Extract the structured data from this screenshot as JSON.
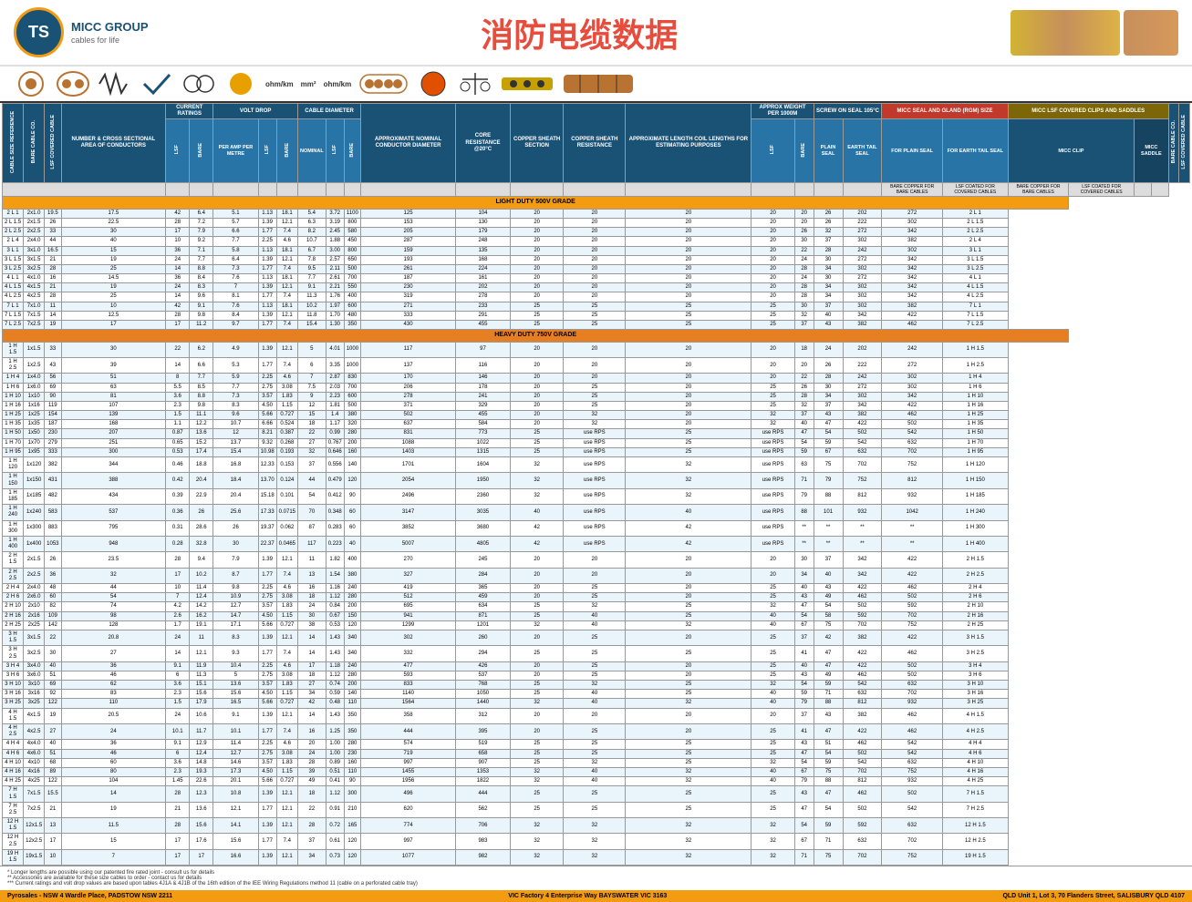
{
  "page": {
    "title": "消防电缆数据",
    "logo_text": "MICC GROUP",
    "logo_subtitle": "cables for life",
    "logo_initials": "TS"
  },
  "columns": {
    "cable_size": "CABLE SIZE REFERENCE",
    "bare_cable": "BARE CABLE CO.",
    "lsf_cable": "LSF COVERED CABLE",
    "num_conductors": "NUMBER & CROSS SECTIONAL AREA OF CONDUCTORS",
    "current_lsf": "LSF",
    "current_bare": "BARE",
    "volt_drop_per_amp": "PER AMP PER METRE",
    "volt_drop_lsf": "LSF",
    "volt_drop_bare": "BARE",
    "cable_dia_nominal": "NOMINAL CONDUCTOR DIAMETER",
    "cable_dia_lsf": "LSF",
    "cable_dia_bare": "BARE",
    "copper_sheath_section": "COPPER SHEATH SECTION",
    "copper_sheath_resistance": "COPPER SHEATH RESISTANCE",
    "approx_length": "APPROXIMATE LENGTH COIL LENGTHS FOR ESTIMATING PURPOSES",
    "weight_lsf": "LSF",
    "weight_bare": "BARE",
    "screw_plain": "PLAIN SEAL",
    "screw_earth": "EARTH TAIL SEAL",
    "for_plain_seal": "FOR PLAIN SEAL",
    "for_earth_tail_seal": "FOR EARTH TAIL SEAL",
    "bare_copper_bare": "BARE COPPER FOR BARE CABLES",
    "lsf_covered": "LSF COATED FOR COVERED CABLES",
    "bare_copper_covered": "BARE COPPER FOR BARE CABLES",
    "lsf_saddle": "LSF COATED FOR COVERED CABLES"
  },
  "section_labels": {
    "light_duty": "LIGHT DUTY 500V GRADE",
    "heavy_duty": "HEAVY DUTY 750V GRADE",
    "light_duty_right": "LIGHT DUTY 500V GRADE",
    "heavy_duty_right": "HEAVY DUTY 750V GRADE"
  },
  "rows_light_duty": [
    [
      "2 L 1",
      "2x1.0",
      "19.5",
      "17.5",
      "42",
      "6.4",
      "5.1",
      "1.13",
      "18.1",
      "5.4",
      "3.72",
      "1100",
      "125",
      "104",
      "20",
      "20",
      "20",
      "20",
      "20",
      "26",
      "202",
      "272",
      "2 L 1"
    ],
    [
      "2 L 1.5",
      "2x1.5",
      "26",
      "22.5",
      "28",
      "7.2",
      "5.7",
      "1.39",
      "12.1",
      "6.3",
      "3.19",
      "800",
      "153",
      "130",
      "20",
      "20",
      "20",
      "20",
      "20",
      "26",
      "222",
      "302",
      "2 L 1.5"
    ],
    [
      "2 L 2.5",
      "2x2.5",
      "33",
      "30",
      "17",
      "7.9",
      "6.6",
      "1.77",
      "7.4",
      "8.2",
      "2.45",
      "580",
      "205",
      "179",
      "20",
      "20",
      "20",
      "20",
      "26",
      "32",
      "272",
      "342",
      "2 L 2.5"
    ],
    [
      "2 L 4",
      "2x4.0",
      "44",
      "40",
      "10",
      "9.2",
      "7.7",
      "2.25",
      "4.6",
      "10.7",
      "1.88",
      "450",
      "287",
      "248",
      "20",
      "20",
      "20",
      "20",
      "30",
      "37",
      "302",
      "382",
      "2 L 4"
    ],
    [
      "3 L 1",
      "3x1.0",
      "16.5",
      "15",
      "36",
      "7.1",
      "5.8",
      "1.13",
      "18.1",
      "6.7",
      "3.00",
      "800",
      "159",
      "135",
      "20",
      "20",
      "20",
      "20",
      "22",
      "28",
      "242",
      "302",
      "3 L 1"
    ],
    [
      "3 L 1.5",
      "3x1.5",
      "21",
      "19",
      "24",
      "7.7",
      "6.4",
      "1.39",
      "12.1",
      "7.8",
      "2.57",
      "650",
      "193",
      "168",
      "20",
      "20",
      "20",
      "20",
      "24",
      "30",
      "272",
      "342",
      "3 L 1.5"
    ],
    [
      "3 L 2.5",
      "3x2.5",
      "28",
      "25",
      "14",
      "8.8",
      "7.3",
      "1.77",
      "7.4",
      "9.5",
      "2.11",
      "500",
      "261",
      "224",
      "20",
      "20",
      "20",
      "20",
      "28",
      "34",
      "302",
      "342",
      "3 L 2.5"
    ],
    [
      "4 L 1",
      "4x1.0",
      "16",
      "14.5",
      "36",
      "8.4",
      "7.6",
      "1.13",
      "18.1",
      "7.7",
      "2.61",
      "700",
      "187",
      "161",
      "20",
      "20",
      "20",
      "20",
      "24",
      "30",
      "272",
      "342",
      "4 L 1"
    ],
    [
      "4 L 1.5",
      "4x1.5",
      "21",
      "19",
      "24",
      "8.3",
      "7",
      "1.39",
      "12.1",
      "9.1",
      "2.21",
      "550",
      "230",
      "202",
      "20",
      "20",
      "20",
      "20",
      "28",
      "34",
      "302",
      "342",
      "4 L 1.5"
    ],
    [
      "4 L 2.5",
      "4x2.5",
      "28",
      "25",
      "14",
      "9.6",
      "8.1",
      "1.77",
      "7.4",
      "11.3",
      "1.76",
      "400",
      "319",
      "278",
      "20",
      "20",
      "20",
      "20",
      "28",
      "34",
      "302",
      "342",
      "4 L 2.5"
    ],
    [
      "7 L 1",
      "7x1.0",
      "11",
      "10",
      "42",
      "9.1",
      "7.6",
      "1.13",
      "18.1",
      "10.2",
      "1.97",
      "600",
      "271",
      "233",
      "25",
      "25",
      "25",
      "25",
      "30",
      "37",
      "302",
      "382",
      "7 L 1"
    ],
    [
      "7 L 1.5",
      "7x1.5",
      "14",
      "12.5",
      "28",
      "9.8",
      "8.4",
      "1.39",
      "12.1",
      "11.8",
      "1.70",
      "480",
      "333",
      "291",
      "25",
      "25",
      "25",
      "25",
      "32",
      "40",
      "342",
      "422",
      "7 L 1.5"
    ],
    [
      "7 L 2.5",
      "7x2.5",
      "19",
      "17",
      "17",
      "11.2",
      "9.7",
      "1.77",
      "7.4",
      "15.4",
      "1.30",
      "350",
      "430",
      "455",
      "25",
      "25",
      "25",
      "25",
      "37",
      "43",
      "382",
      "462",
      "7 L 2.5"
    ]
  ],
  "rows_heavy_duty": [
    [
      "1 H 1.5",
      "1x1.5",
      "33",
      "30",
      "22",
      "6.2",
      "4.9",
      "1.39",
      "12.1",
      "5",
      "4.01",
      "1000",
      "117",
      "97",
      "20",
      "20",
      "20",
      "20",
      "18",
      "24",
      "202",
      "242",
      "1 H 1.5"
    ],
    [
      "1 H 2.5",
      "1x2.5",
      "43",
      "39",
      "14",
      "6.6",
      "5.3",
      "1.77",
      "7.4",
      "6",
      "3.35",
      "1000",
      "137",
      "116",
      "20",
      "20",
      "20",
      "20",
      "20",
      "26",
      "222",
      "272",
      "1 H 2.5"
    ],
    [
      "1 H 4",
      "1x4.0",
      "56",
      "51",
      "8",
      "7.7",
      "5.9",
      "2.25",
      "4.6",
      "7",
      "2.87",
      "830",
      "170",
      "146",
      "20",
      "20",
      "20",
      "20",
      "22",
      "28",
      "242",
      "302",
      "1 H 4"
    ],
    [
      "1 H 6",
      "1x6.0",
      "69",
      "63",
      "5.5",
      "8.5",
      "7.7",
      "2.75",
      "3.08",
      "7.5",
      "2.03",
      "700",
      "206",
      "178",
      "20",
      "25",
      "20",
      "25",
      "26",
      "30",
      "272",
      "302",
      "1 H 6"
    ],
    [
      "1 H 10",
      "1x10",
      "90",
      "81",
      "3.6",
      "8.8",
      "7.3",
      "3.57",
      "1.83",
      "9",
      "2.23",
      "600",
      "278",
      "241",
      "20",
      "25",
      "20",
      "25",
      "28",
      "34",
      "302",
      "342",
      "1 H 10"
    ],
    [
      "1 H 16",
      "1x16",
      "119",
      "107",
      "2.3",
      "9.8",
      "8.3",
      "4.50",
      "1.15",
      "12",
      "1.81",
      "500",
      "371",
      "329",
      "20",
      "25",
      "20",
      "25",
      "32",
      "37",
      "342",
      "422",
      "1 H 16"
    ],
    [
      "1 H 25",
      "1x25",
      "154",
      "139",
      "1.5",
      "11.1",
      "9.6",
      "5.66",
      "0.727",
      "15",
      "1.4",
      "380",
      "502",
      "455",
      "20",
      "32",
      "20",
      "32",
      "37",
      "43",
      "382",
      "462",
      "1 H 25"
    ],
    [
      "1 H 35",
      "1x35",
      "187",
      "168",
      "1.1",
      "12.2",
      "10.7",
      "6.66",
      "0.524",
      "18",
      "1.17",
      "320",
      "637",
      "584",
      "20",
      "32",
      "20",
      "32",
      "40",
      "47",
      "422",
      "502",
      "1 H 35"
    ],
    [
      "1 H 50",
      "1x50",
      "230",
      "207",
      "0.87",
      "13.6",
      "12",
      "8.21",
      "0.387",
      "22",
      "0.99",
      "280",
      "831",
      "773",
      "25",
      "use RPS",
      "25",
      "use RPS",
      "47",
      "54",
      "502",
      "542",
      "1 H 50"
    ],
    [
      "1 H 70",
      "1x70",
      "279",
      "251",
      "0.65",
      "15.2",
      "13.7",
      "9.32",
      "0.268",
      "27",
      "0.767",
      "200",
      "1088",
      "1022",
      "25",
      "use RPS",
      "25",
      "use RPS",
      "54",
      "59",
      "542",
      "632",
      "1 H 70"
    ],
    [
      "1 H 95",
      "1x95",
      "333",
      "300",
      "0.53",
      "17.4",
      "15.4",
      "10.98",
      "0.193",
      "32",
      "0.646",
      "160",
      "1403",
      "1315",
      "25",
      "use RPS",
      "25",
      "use RPS",
      "59",
      "67",
      "632",
      "702",
      "1 H 95"
    ],
    [
      "1 H 120",
      "1x120",
      "382",
      "344",
      "0.46",
      "18.8",
      "16.8",
      "12.33",
      "0.153",
      "37",
      "0.556",
      "140",
      "1701",
      "1604",
      "32",
      "use RPS",
      "32",
      "use RPS",
      "63",
      "75",
      "702",
      "752",
      "1 H 120"
    ],
    [
      "1 H 150",
      "1x150",
      "431",
      "388",
      "0.42",
      "20.4",
      "18.4",
      "13.70",
      "0.124",
      "44",
      "0.479",
      "120",
      "2054",
      "1950",
      "32",
      "use RPS",
      "32",
      "use RPS",
      "71",
      "79",
      "752",
      "812",
      "1 H 150"
    ],
    [
      "1 H 185",
      "1x185",
      "482",
      "434",
      "0.39",
      "22.9",
      "20.4",
      "15.18",
      "0.101",
      "54",
      "0.412",
      "90",
      "2496",
      "2360",
      "32",
      "use RPS",
      "32",
      "use RPS",
      "79",
      "88",
      "812",
      "932",
      "1 H 185"
    ],
    [
      "1 H 240",
      "1x240",
      "583",
      "537",
      "0.36",
      "26",
      "25.6",
      "17.33",
      "0.0715",
      "70",
      "0.348",
      "60",
      "3147",
      "3035",
      "40",
      "use RPS",
      "40",
      "use RPS",
      "88",
      "101",
      "932",
      "1042",
      "1 H 240"
    ],
    [
      "1 H 300",
      "1x300",
      "883",
      "795",
      "0.31",
      "28.6",
      "26",
      "19.37",
      "0.062",
      "87",
      "0.283",
      "60",
      "3852",
      "3680",
      "42",
      "use RPS",
      "42",
      "use RPS",
      "**",
      "**",
      "**",
      "**",
      "1 H 300"
    ],
    [
      "1 H 400",
      "1x400",
      "1053",
      "948",
      "0.28",
      "32.8",
      "30",
      "22.37",
      "0.0465",
      "117",
      "0.223",
      "40",
      "5007",
      "4805",
      "42",
      "use RPS",
      "42",
      "use RPS",
      "**",
      "**",
      "**",
      "**",
      "1 H 400"
    ],
    [
      "2 H 1.5",
      "2x1.5",
      "26",
      "23.5",
      "28",
      "9.4",
      "7.9",
      "1.39",
      "12.1",
      "11",
      "1.82",
      "400",
      "270",
      "245",
      "20",
      "20",
      "20",
      "20",
      "30",
      "37",
      "342",
      "422",
      "2 H 1.5"
    ],
    [
      "2 H 2.5",
      "2x2.5",
      "36",
      "32",
      "17",
      "10.2",
      "8.7",
      "1.77",
      "7.4",
      "13",
      "1.54",
      "380",
      "327",
      "284",
      "20",
      "20",
      "20",
      "20",
      "34",
      "40",
      "342",
      "422",
      "2 H 2.5"
    ],
    [
      "2 H 4",
      "2x4.0",
      "48",
      "44",
      "10",
      "11.4",
      "9.8",
      "2.25",
      "4.6",
      "16",
      "1.16",
      "240",
      "419",
      "365",
      "20",
      "25",
      "20",
      "25",
      "40",
      "43",
      "422",
      "462",
      "2 H 4"
    ],
    [
      "2 H 6",
      "2x6.0",
      "60",
      "54",
      "7",
      "12.4",
      "10.9",
      "2.75",
      "3.08",
      "18",
      "1.12",
      "280",
      "512",
      "459",
      "20",
      "25",
      "20",
      "25",
      "43",
      "49",
      "462",
      "502",
      "2 H 6"
    ],
    [
      "2 H 10",
      "2x10",
      "82",
      "74",
      "4.2",
      "14.2",
      "12.7",
      "3.57",
      "1.83",
      "24",
      "0.84",
      "200",
      "695",
      "634",
      "25",
      "32",
      "25",
      "32",
      "47",
      "54",
      "502",
      "592",
      "2 H 10"
    ],
    [
      "2 H 16",
      "2x16",
      "109",
      "98",
      "2.6",
      "16.2",
      "14.7",
      "4.50",
      "1.15",
      "30",
      "0.67",
      "150",
      "941",
      "871",
      "25",
      "40",
      "25",
      "40",
      "54",
      "58",
      "592",
      "702",
      "2 H 16"
    ],
    [
      "2 H 25",
      "2x25",
      "142",
      "128",
      "1.7",
      "19.1",
      "17.1",
      "5.66",
      "0.727",
      "38",
      "0.53",
      "120",
      "1299",
      "1201",
      "32",
      "40",
      "32",
      "40",
      "67",
      "75",
      "702",
      "752",
      "2 H 25"
    ],
    [
      "3 H 1.5",
      "3x1.5",
      "22",
      "20.8",
      "24",
      "11",
      "8.3",
      "1.39",
      "12.1",
      "14",
      "1.43",
      "340",
      "302",
      "260",
      "20",
      "25",
      "20",
      "25",
      "37",
      "42",
      "382",
      "422",
      "3 H 1.5"
    ],
    [
      "3 H 2.5",
      "3x2.5",
      "30",
      "27",
      "14",
      "12.1",
      "9.3",
      "1.77",
      "7.4",
      "14",
      "1.43",
      "340",
      "332",
      "294",
      "25",
      "25",
      "25",
      "25",
      "41",
      "47",
      "422",
      "462",
      "3 H 2.5"
    ],
    [
      "3 H 4",
      "3x4.0",
      "40",
      "36",
      "9.1",
      "11.9",
      "10.4",
      "2.25",
      "4.6",
      "17",
      "1.18",
      "240",
      "477",
      "426",
      "20",
      "25",
      "20",
      "25",
      "40",
      "47",
      "422",
      "502",
      "3 H 4"
    ],
    [
      "3 H 6",
      "3x6.0",
      "51",
      "46",
      "6",
      "11.3",
      "5",
      "2.75",
      "3.08",
      "18",
      "1.12",
      "280",
      "593",
      "537",
      "20",
      "25",
      "20",
      "25",
      "43",
      "49",
      "462",
      "502",
      "3 H 6"
    ],
    [
      "3 H 10",
      "3x10",
      "69",
      "62",
      "3.6",
      "15.1",
      "13.6",
      "3.57",
      "1.83",
      "27",
      "0.74",
      "200",
      "833",
      "768",
      "25",
      "32",
      "25",
      "32",
      "54",
      "59",
      "542",
      "632",
      "3 H 10"
    ],
    [
      "3 H 16",
      "3x16",
      "92",
      "83",
      "2.3",
      "15.6",
      "15.6",
      "4.50",
      "1.15",
      "34",
      "0.59",
      "140",
      "1140",
      "1050",
      "25",
      "40",
      "25",
      "40",
      "59",
      "71",
      "632",
      "702",
      "3 H 16"
    ],
    [
      "3 H 25",
      "3x25",
      "122",
      "110",
      "1.5",
      "17.9",
      "16.5",
      "5.66",
      "0.727",
      "42",
      "0.48",
      "110",
      "1564",
      "1440",
      "32",
      "40",
      "32",
      "40",
      "79",
      "88",
      "812",
      "932",
      "3 H 25"
    ],
    [
      "4 H 1.5",
      "4x1.5",
      "19",
      "20.5",
      "24",
      "10.6",
      "9.1",
      "1.39",
      "12.1",
      "14",
      "1.43",
      "350",
      "358",
      "312",
      "20",
      "20",
      "20",
      "20",
      "37",
      "43",
      "382",
      "462",
      "4 H 1.5"
    ],
    [
      "4 H 2.5",
      "4x2.5",
      "27",
      "24",
      "10.1",
      "11.7",
      "10.1",
      "1.77",
      "7.4",
      "16",
      "1.25",
      "350",
      "444",
      "395",
      "20",
      "25",
      "20",
      "25",
      "41",
      "47",
      "422",
      "462",
      "4 H 2.5"
    ],
    [
      "4 H 4",
      "4x4.0",
      "40",
      "36",
      "9.1",
      "12.9",
      "11.4",
      "2.25",
      "4.6",
      "20",
      "1.00",
      "280",
      "574",
      "519",
      "25",
      "25",
      "25",
      "25",
      "43",
      "51",
      "462",
      "542",
      "4 H 4"
    ],
    [
      "4 H 6",
      "4x6.0",
      "51",
      "46",
      "6",
      "12.4",
      "12.7",
      "2.75",
      "3.08",
      "24",
      "1.00",
      "230",
      "719",
      "658",
      "25",
      "25",
      "25",
      "25",
      "47",
      "54",
      "502",
      "542",
      "4 H 6"
    ],
    [
      "4 H 10",
      "4x10",
      "68",
      "60",
      "3.6",
      "14.8",
      "14.6",
      "3.57",
      "1.83",
      "28",
      "0.89",
      "160",
      "997",
      "907",
      "25",
      "32",
      "25",
      "32",
      "54",
      "59",
      "542",
      "632",
      "4 H 10"
    ],
    [
      "4 H 16",
      "4x16",
      "89",
      "80",
      "2.3",
      "19.3",
      "17.3",
      "4.50",
      "1.15",
      "39",
      "0.51",
      "110",
      "1455",
      "1353",
      "32",
      "40",
      "32",
      "40",
      "67",
      "75",
      "702",
      "752",
      "4 H 16"
    ],
    [
      "4 H 25",
      "4x25",
      "122",
      "104",
      "1.45",
      "22.6",
      "20.1",
      "5.66",
      "0.727",
      "49",
      "0.41",
      "90",
      "1956",
      "1822",
      "32",
      "40",
      "32",
      "40",
      "79",
      "88",
      "812",
      "932",
      "4 H 25"
    ],
    [
      "7 H 1.5",
      "7x1.5",
      "15.5",
      "14",
      "28",
      "12.3",
      "10.8",
      "1.39",
      "12.1",
      "18",
      "1.12",
      "300",
      "496",
      "444",
      "25",
      "25",
      "25",
      "25",
      "43",
      "47",
      "462",
      "502",
      "7 H 1.5"
    ],
    [
      "7 H 2.5",
      "7x2.5",
      "21",
      "19",
      "21",
      "13.6",
      "12.1",
      "1.77",
      "12.1",
      "22",
      "0.91",
      "210",
      "620",
      "562",
      "25",
      "25",
      "25",
      "25",
      "47",
      "54",
      "502",
      "542",
      "7 H 2.5"
    ],
    [
      "12 H 1.5",
      "12x1.5",
      "13",
      "11.5",
      "28",
      "15.6",
      "14.1",
      "1.39",
      "12.1",
      "28",
      "0.72",
      "165",
      "774",
      "706",
      "32",
      "32",
      "32",
      "32",
      "54",
      "59",
      "592",
      "632",
      "12 H 1.5"
    ],
    [
      "12 H 2.5",
      "12x2.5",
      "17",
      "15",
      "17",
      "17.6",
      "15.6",
      "1.77",
      "7.4",
      "37",
      "0.61",
      "120",
      "997",
      "983",
      "32",
      "32",
      "32",
      "32",
      "67",
      "71",
      "632",
      "702",
      "12 H 2.5"
    ],
    [
      "19 H 1.5",
      "19x1.5",
      "10",
      "7",
      "17",
      "17",
      "16.6",
      "1.39",
      "12.1",
      "34",
      "0.73",
      "120",
      "1077",
      "982",
      "32",
      "32",
      "32",
      "32",
      "71",
      "75",
      "702",
      "752",
      "19 H 1.5"
    ]
  ],
  "footer": {
    "note1": "* Longer lengths are possible using our patented fire rated joint - consult us for details",
    "note2": "** Accessories are available for these size cables to order - contact us for details",
    "note3": "*** Current ratings and volt drop values are based upon tables 4J1A & 4J1B of the 16th edition of the IEE Wiring Regulations method 11 (cable on a perforated cable tray)",
    "addresses": [
      "Pyrosales - NSW 4 Wardle Place, PADSTOW NSW 2211",
      "VIC Factory 4 Enterprise Way BAYSWATER VIC 3163",
      "QLD Unit 1, Lot 3, 70 Flanders Street, SALISBURY QLD 4107"
    ]
  }
}
